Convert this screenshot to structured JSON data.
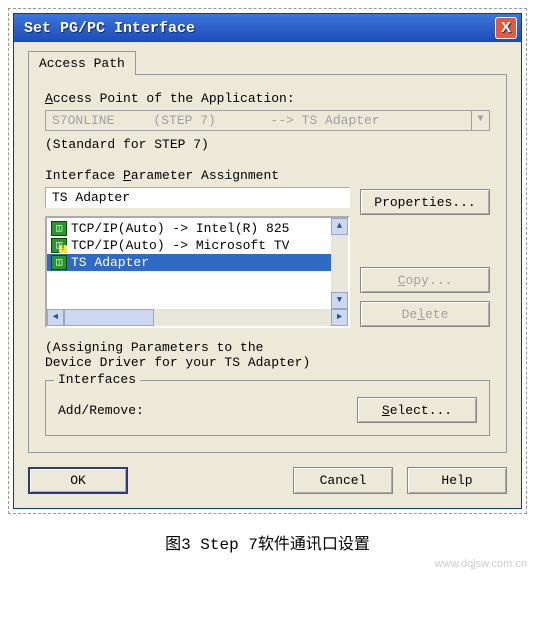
{
  "window": {
    "title": "Set PG/PC Interface",
    "close_icon": "X"
  },
  "tab": {
    "label": "Access Path"
  },
  "access_point": {
    "label_pre": "A",
    "label_rest": "ccess Point of the Application:",
    "dropdown_text": "S7ONLINE     (STEP 7)       --> TS Adapter",
    "hint": "(Standard for STEP 7)"
  },
  "interface_param": {
    "label_pre": "Interface ",
    "label_u": "P",
    "label_post": "arameter Assignment",
    "current": "TS Adapter",
    "items": [
      {
        "icon": "net",
        "warn": false,
        "text": "TCP/IP(Auto) -> Intel(R) 825"
      },
      {
        "icon": "net",
        "warn": true,
        "text": "TCP/IP(Auto) -> Microsoft TV"
      },
      {
        "icon": "net",
        "warn": false,
        "text": "TS Adapter",
        "selected": true
      }
    ],
    "note": "(Assigning Parameters to the\nDevice Driver for your TS Adapter)"
  },
  "buttons": {
    "properties": "Properties...",
    "copy": "Copy...",
    "delete": "Delete"
  },
  "interfaces": {
    "legend": "Interfaces",
    "label": "Add/Remove:",
    "btn": "Select..."
  },
  "bottom": {
    "ok": "OK",
    "cancel": "Cancel",
    "help": "Help"
  },
  "caption": "图3 Step 7软件通讯口设置",
  "watermark": "www.dqjsw.com.cn"
}
